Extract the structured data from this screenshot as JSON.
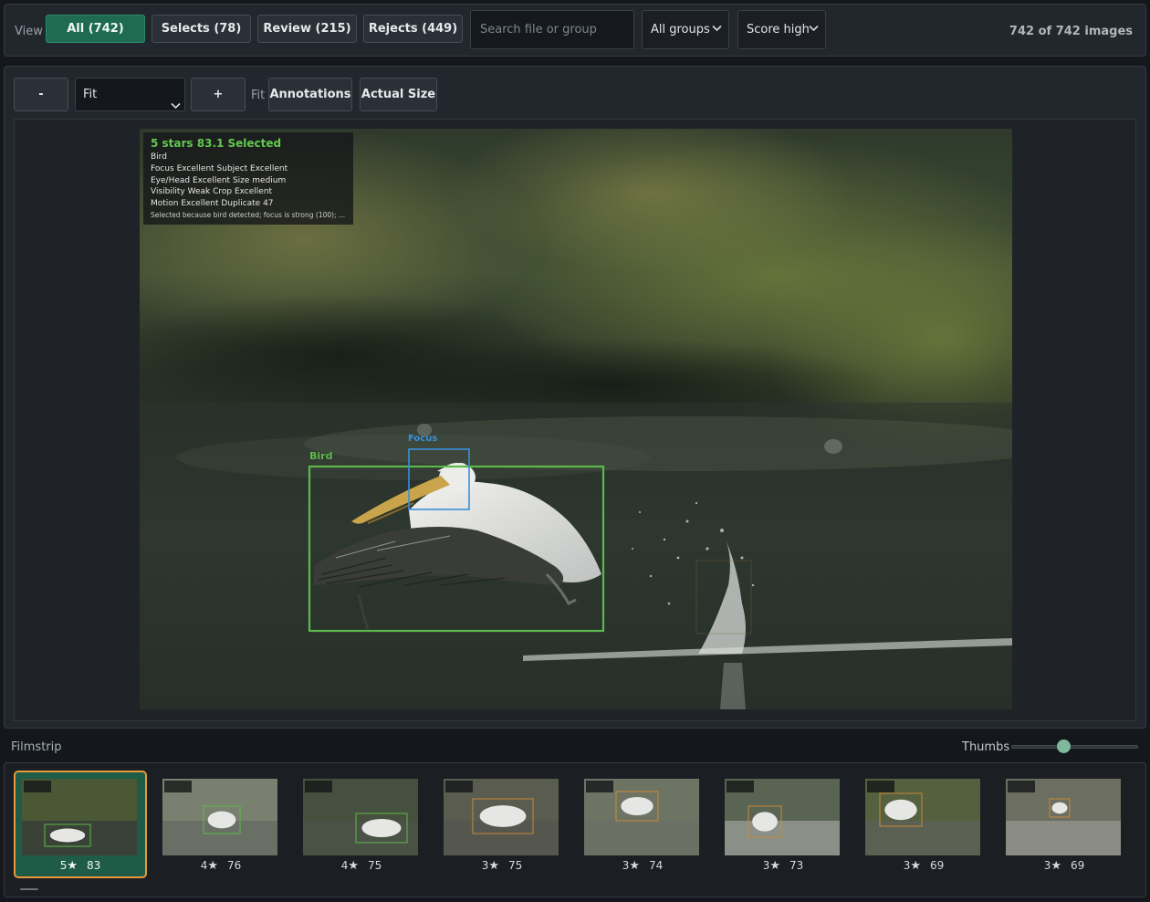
{
  "toolbar": {
    "view_label": "View",
    "filters": [
      {
        "label": "All (742)",
        "active": true
      },
      {
        "label": "Selects (78)",
        "active": false
      },
      {
        "label": "Review (215)",
        "active": false
      },
      {
        "label": "Rejects (449)",
        "active": false
      }
    ],
    "search_placeholder": "Search file or group",
    "group_select": "All groups",
    "sort_select": "Score high",
    "count": "742 of 742 images"
  },
  "viewer": {
    "zoom_out": "-",
    "zoom_select": "Fit",
    "zoom_in": "+",
    "fit_label": "Fit",
    "annotations_button": "Annotations",
    "actual_size_button": "Actual Size",
    "overlay": {
      "header": "5 stars   83.1   Selected",
      "lines": [
        "Bird",
        "Focus Excellent   Subject Excellent",
        "Eye/Head Excellent   Size medium",
        "Visibility Weak   Crop Excellent",
        "Motion Excellent   Duplicate 47"
      ],
      "reason": "Selected because bird detected; focus is strong (100); ..."
    },
    "boxes": {
      "bird_label": "Bird",
      "focus_label": "Focus"
    },
    "colors": {
      "bird_box": "#5cb84a",
      "focus_box": "#3a8fdc"
    }
  },
  "filmstrip": {
    "label": "Filmstrip",
    "thumbs_label": "Thumbs",
    "thumb_size_value": 0.42,
    "items": [
      {
        "stars": "5",
        "score": "83",
        "selected": true
      },
      {
        "stars": "4",
        "score": "76",
        "selected": false
      },
      {
        "stars": "4",
        "score": "75",
        "selected": false
      },
      {
        "stars": "3",
        "score": "75",
        "selected": false
      },
      {
        "stars": "3",
        "score": "74",
        "selected": false
      },
      {
        "stars": "3",
        "score": "73",
        "selected": false
      },
      {
        "stars": "3",
        "score": "69",
        "selected": false
      },
      {
        "stars": "3",
        "score": "69",
        "selected": false
      }
    ]
  }
}
